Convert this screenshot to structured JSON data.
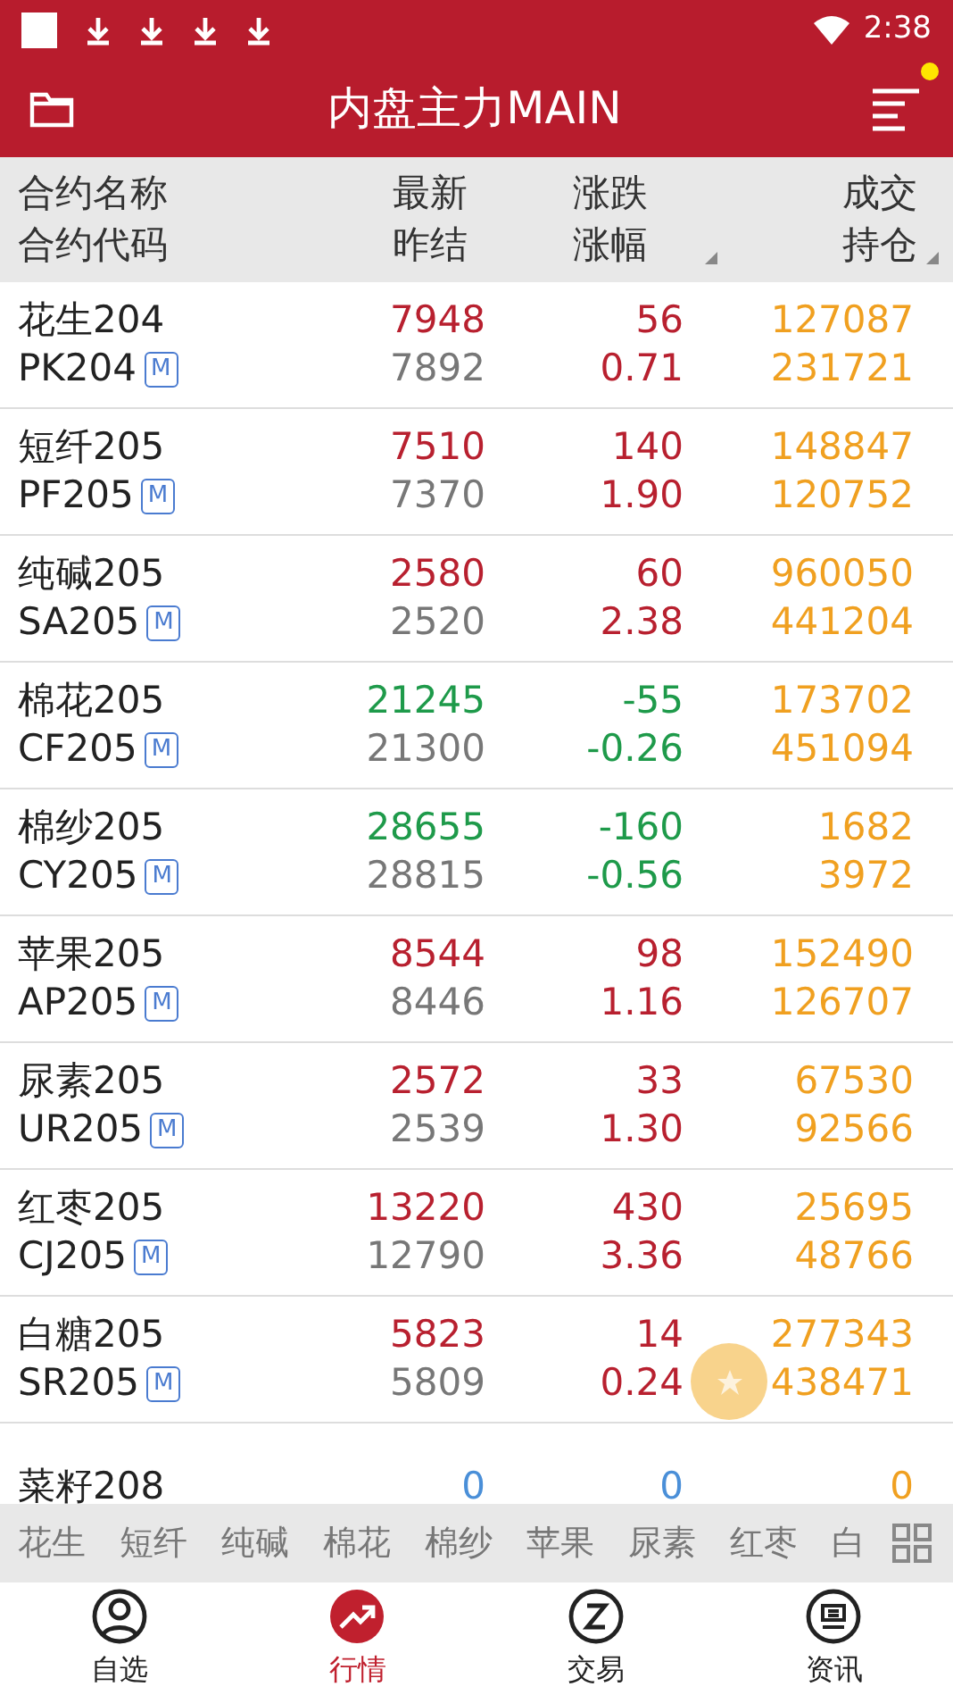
{
  "status_bar": {
    "time": "2:38"
  },
  "header": {
    "title": "内盘主力MAIN",
    "menu_badge": true
  },
  "columns": [
    {
      "line1": "合约名称",
      "line2": "合约代码",
      "sortable": false
    },
    {
      "line1": "最新",
      "line2": "昨结",
      "sortable": false
    },
    {
      "line1": "涨跌",
      "line2": "涨幅",
      "sortable": true
    },
    {
      "line1": "成交",
      "line2": "持仓",
      "sortable": true
    }
  ],
  "rows": [
    {
      "name": "花生204",
      "code": "PK204",
      "badge": "M",
      "last": "7948",
      "prev": "7892",
      "change": "56",
      "pct": "0.71",
      "volume": "127087",
      "open_interest": "231721",
      "kind": "up"
    },
    {
      "name": "短纤205",
      "code": "PF205",
      "badge": "M",
      "last": "7510",
      "prev": "7370",
      "change": "140",
      "pct": "1.90",
      "volume": "148847",
      "open_interest": "120752",
      "kind": "up"
    },
    {
      "name": "纯碱205",
      "code": "SA205",
      "badge": "M",
      "last": "2580",
      "prev": "2520",
      "change": "60",
      "pct": "2.38",
      "volume": "960050",
      "open_interest": "441204",
      "kind": "up"
    },
    {
      "name": "棉花205",
      "code": "CF205",
      "badge": "M",
      "last": "21245",
      "prev": "21300",
      "change": "-55",
      "pct": "-0.26",
      "volume": "173702",
      "open_interest": "451094",
      "kind": "down"
    },
    {
      "name": "棉纱205",
      "code": "CY205",
      "badge": "M",
      "last": "28655",
      "prev": "28815",
      "change": "-160",
      "pct": "-0.56",
      "volume": "1682",
      "open_interest": "3972",
      "kind": "down"
    },
    {
      "name": "苹果205",
      "code": "AP205",
      "badge": "M",
      "last": "8544",
      "prev": "8446",
      "change": "98",
      "pct": "1.16",
      "volume": "152490",
      "open_interest": "126707",
      "kind": "up"
    },
    {
      "name": "尿素205",
      "code": "UR205",
      "badge": "M",
      "last": "2572",
      "prev": "2539",
      "change": "33",
      "pct": "1.30",
      "volume": "67530",
      "open_interest": "92566",
      "kind": "up"
    },
    {
      "name": "红枣205",
      "code": "CJ205",
      "badge": "M",
      "last": "13220",
      "prev": "12790",
      "change": "430",
      "pct": "3.36",
      "volume": "25695",
      "open_interest": "48766",
      "kind": "up"
    },
    {
      "name": "白糖205",
      "code": "SR205",
      "badge": "M",
      "last": "5823",
      "prev": "5809",
      "change": "14",
      "pct": "0.24",
      "volume": "277343",
      "open_interest": "438471",
      "kind": "up"
    },
    {
      "name": "菜籽208",
      "last": "0",
      "change": "0",
      "volume": "0",
      "kind": "flat"
    }
  ],
  "quick_bar": [
    "花生",
    "短纤",
    "纯碱",
    "棉花",
    "棉纱",
    "苹果",
    "尿素",
    "红枣",
    "白"
  ],
  "nav": [
    {
      "label": "自选",
      "kind": "person",
      "selected": false
    },
    {
      "label": "行情",
      "kind": "chart",
      "selected": true
    },
    {
      "label": "交易",
      "kind": "trade",
      "selected": false
    },
    {
      "label": "资讯",
      "kind": "news",
      "selected": false
    }
  ]
}
